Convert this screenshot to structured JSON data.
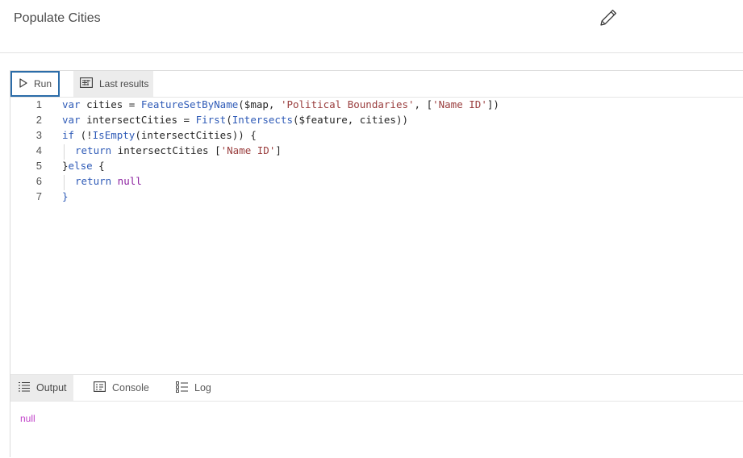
{
  "header": {
    "title": "Populate Cities",
    "edit_icon": "pencil-icon"
  },
  "toolbar": {
    "run_label": "Run",
    "run_icon": "play-icon",
    "last_results_label": "Last results",
    "last_results_icon": "results-icon"
  },
  "editor": {
    "lines": [
      {
        "number": "1"
      },
      {
        "number": "2"
      },
      {
        "number": "3"
      },
      {
        "number": "4"
      },
      {
        "number": "5"
      },
      {
        "number": "6"
      },
      {
        "number": "7"
      }
    ],
    "code": {
      "l1": {
        "kw": "var",
        "name": " cities = ",
        "fn": "FeatureSetByName",
        "p1": "($map, ",
        "s1": "'Political Boundaries'",
        "p2": ", [",
        "s2": "'Name ID'",
        "p3": "])"
      },
      "l2": {
        "kw": "var",
        "name": " intersectCities = ",
        "fn": "First",
        "p1": "(",
        "fn2": "Intersects",
        "p2": "($feature, cities))"
      },
      "l3": {
        "kw": "if",
        "p1": " (!",
        "fn": "IsEmpty",
        "p2": "(intersectCities)) {"
      },
      "l4": {
        "kw": "return",
        "p1": " intersectCities [",
        "s1": "'Name ID'",
        "p2": "]"
      },
      "l5": {
        "p1": "}",
        "kw": "else",
        "p2": " {"
      },
      "l6": {
        "kw": "return",
        "kw2": " null"
      },
      "l7": {
        "p1": "}"
      }
    }
  },
  "output_tabs": [
    {
      "label": "Output",
      "icon": "list-icon",
      "active": true
    },
    {
      "label": "Console",
      "icon": "console-icon",
      "active": false
    },
    {
      "label": "Log",
      "icon": "log-icon",
      "active": false
    }
  ],
  "output": {
    "value": "null"
  },
  "colors": {
    "accent": "#2b6ca8",
    "keyword": "#2f5bb7",
    "string": "#9a3e3e",
    "null": "#c040c9"
  }
}
